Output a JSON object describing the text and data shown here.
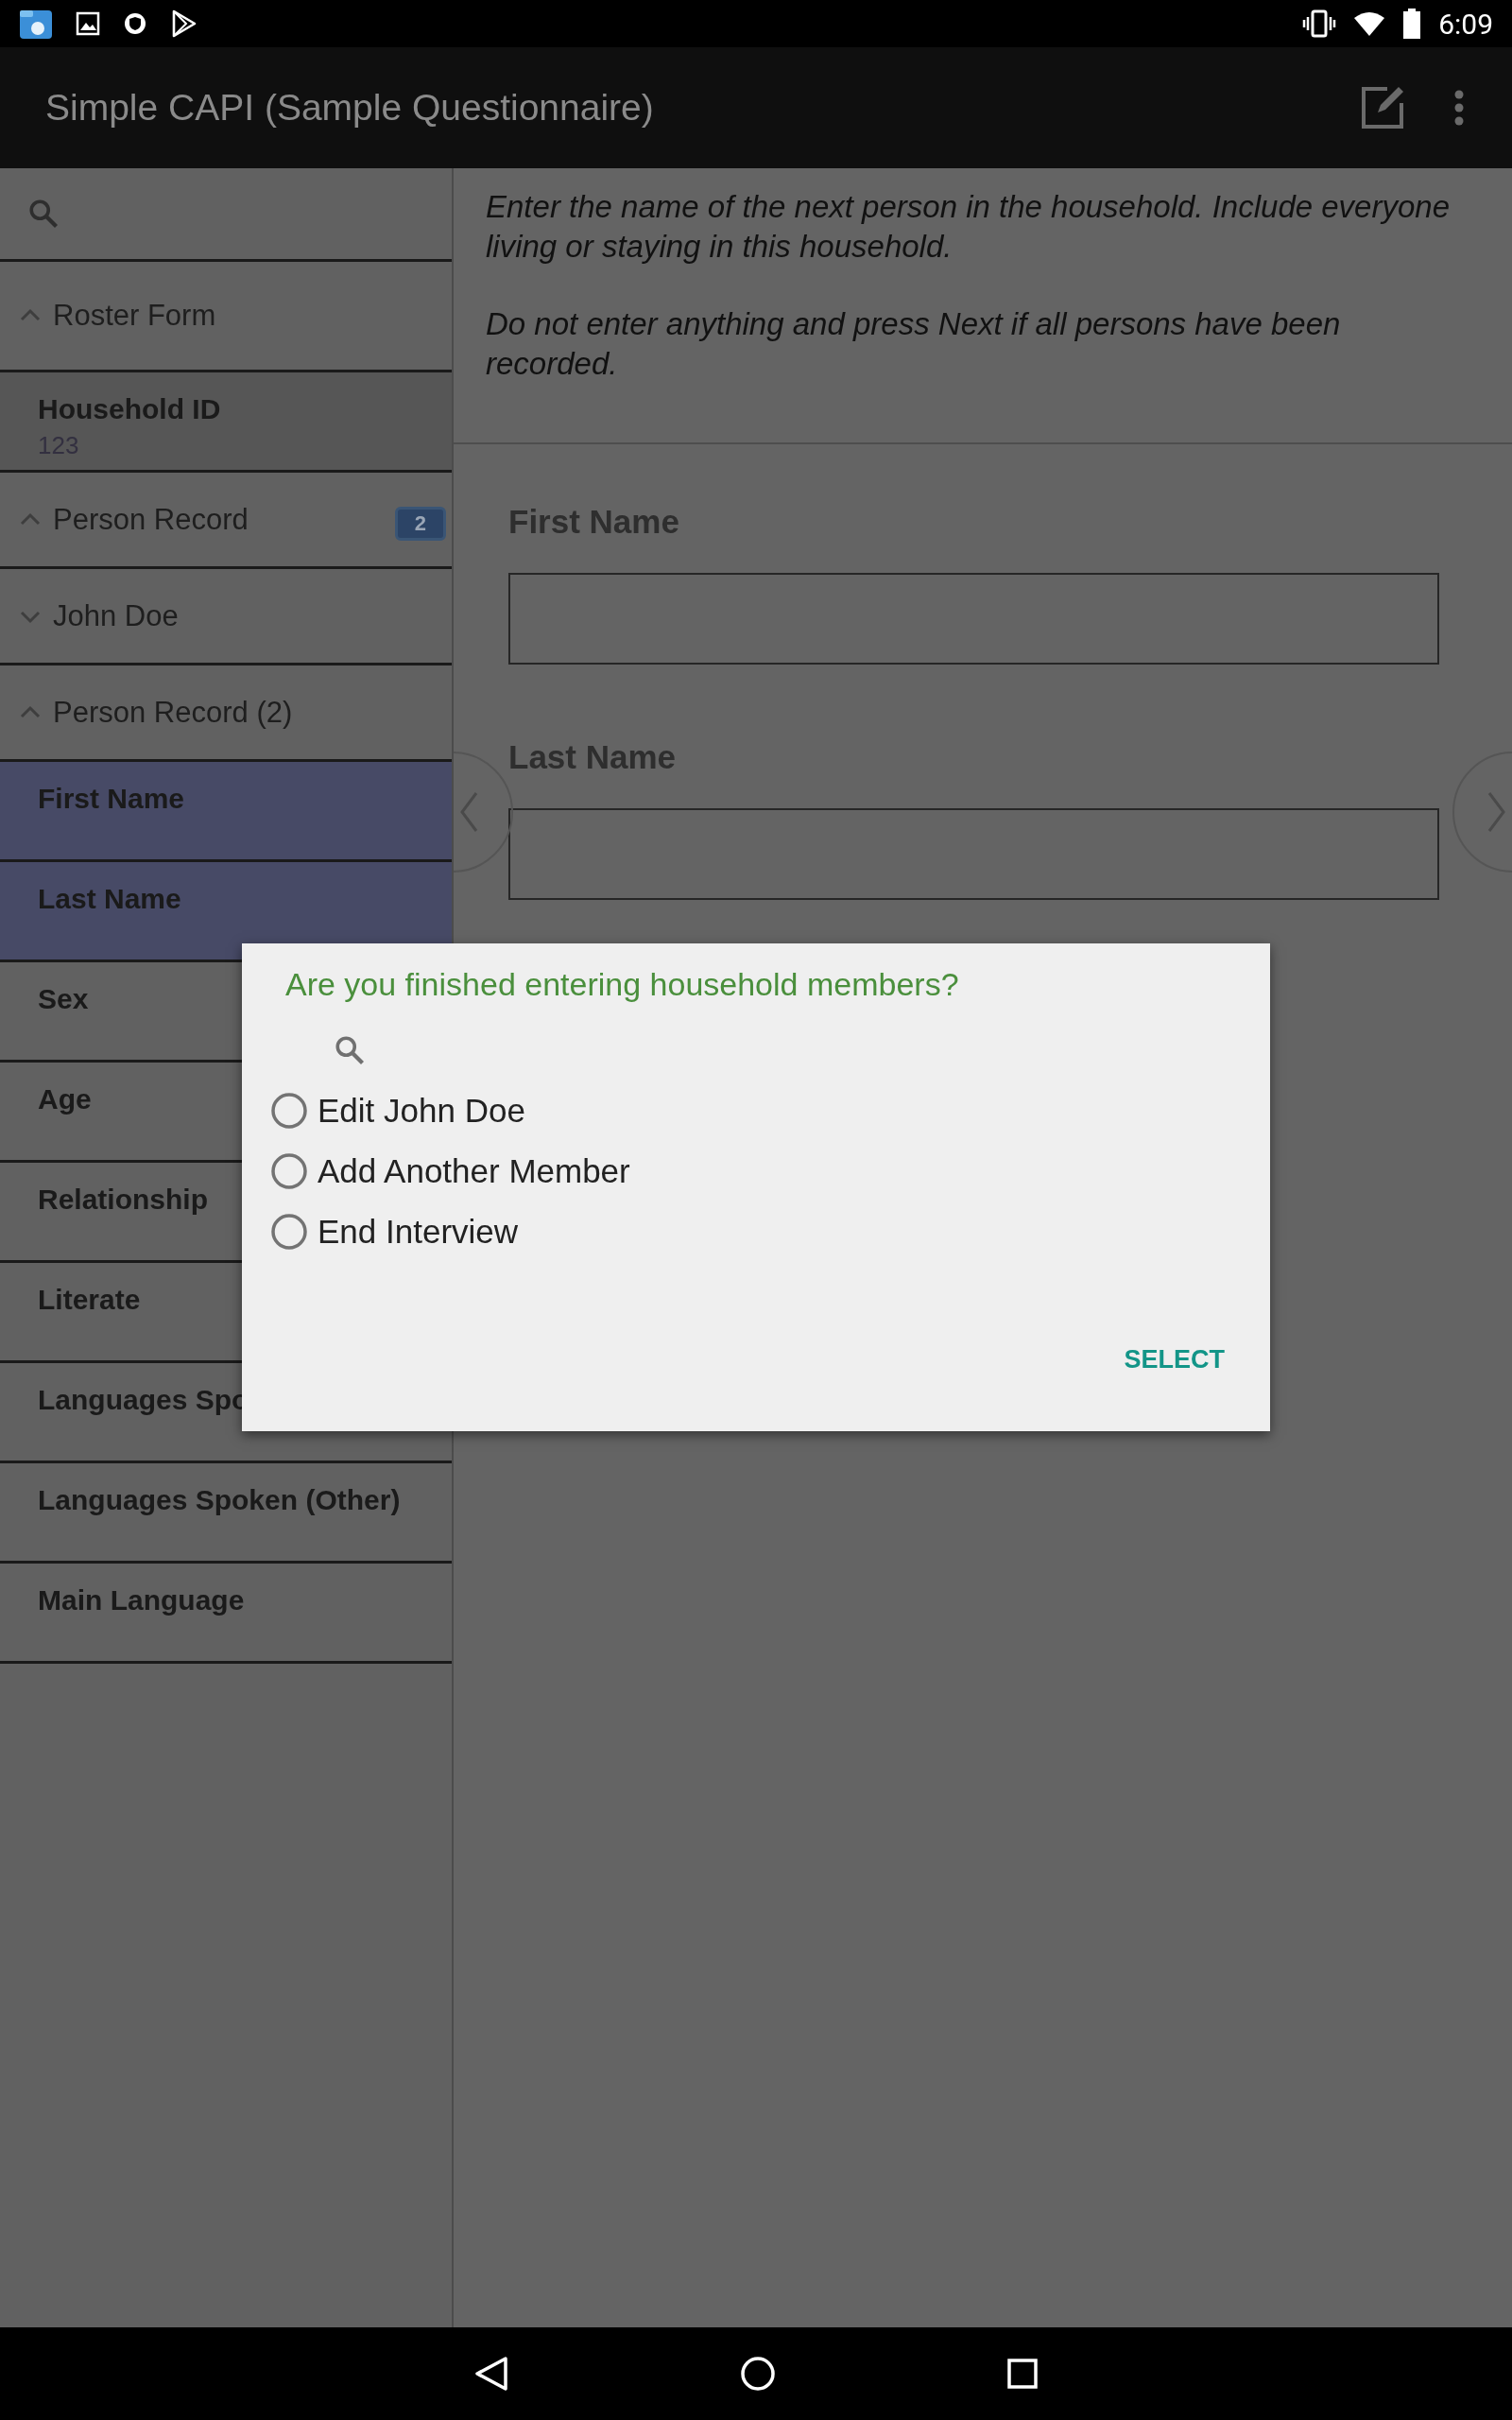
{
  "status_bar": {
    "time": "6:09"
  },
  "app_bar": {
    "title": "Simple CAPI (Sample Questionnaire)"
  },
  "sidebar": {
    "items": [
      {
        "kind": "group",
        "label": "Roster Form",
        "expanded": true
      },
      {
        "kind": "field",
        "label": "Household ID",
        "value": "123",
        "current": false
      },
      {
        "kind": "group",
        "label": "Person Record",
        "expanded": true,
        "badge": "2"
      },
      {
        "kind": "group",
        "label": "John Doe",
        "expanded": false
      },
      {
        "kind": "group",
        "label": "Person Record (2)",
        "expanded": true
      },
      {
        "kind": "field",
        "label": "First Name",
        "current": true
      },
      {
        "kind": "field",
        "label": "Last Name",
        "current": true
      },
      {
        "kind": "field",
        "label": "Sex",
        "current": false
      },
      {
        "kind": "field",
        "label": "Age",
        "current": false
      },
      {
        "kind": "field",
        "label": "Relationship",
        "current": false
      },
      {
        "kind": "field",
        "label": "Literate",
        "current": false
      },
      {
        "kind": "field",
        "label": "Languages Spo",
        "current": false
      },
      {
        "kind": "field",
        "label": "Languages Spoken (Other)",
        "current": false
      },
      {
        "kind": "field",
        "label": "Main Language",
        "current": false
      }
    ]
  },
  "question": {
    "instructions": [
      "Enter the name of the next person in the household. Include everyone living or staying in this household.",
      "Do not enter anything and press Next if all persons have been recorded."
    ],
    "fields": [
      {
        "label": "First Name"
      },
      {
        "label": "Last Name"
      }
    ]
  },
  "dialog": {
    "title": "Are you finished entering household members?",
    "options": [
      {
        "label": "Edit John Doe",
        "selected": false
      },
      {
        "label": "Add Another Member",
        "selected": false
      },
      {
        "label": "End Interview",
        "selected": false
      }
    ],
    "button": "SELECT"
  }
}
